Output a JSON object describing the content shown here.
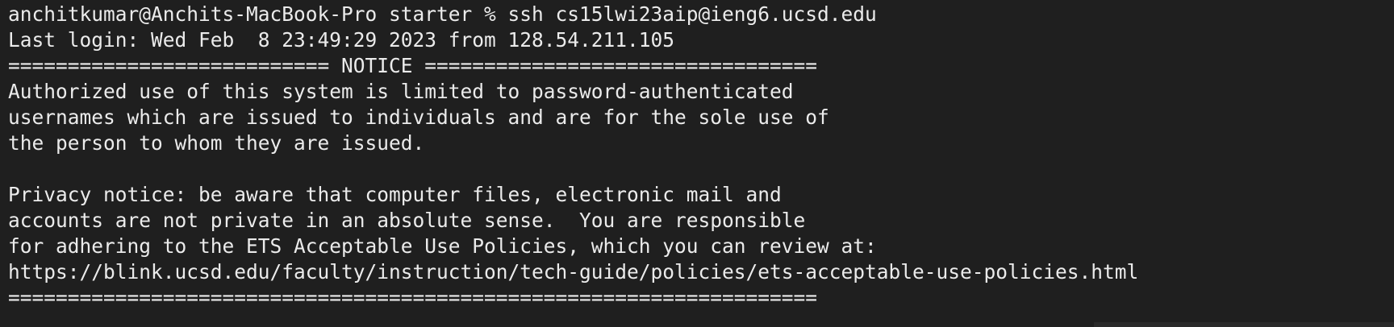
{
  "terminal": {
    "lines": [
      "anchitkumar@Anchits-MacBook-Pro starter % ssh cs15lwi23aip@ieng6.ucsd.edu",
      "Last login: Wed Feb  8 23:49:29 2023 from 128.54.211.105",
      "=========================== NOTICE =================================",
      "Authorized use of this system is limited to password-authenticated",
      "usernames which are issued to individuals and are for the sole use of",
      "the person to whom they are issued.",
      "",
      "Privacy notice: be aware that computer files, electronic mail and",
      "accounts are not private in an absolute sense.  You are responsible",
      "for adhering to the ETS Acceptable Use Policies, which you can review at:",
      "https://blink.ucsd.edu/faculty/instruction/tech-guide/policies/ets-acceptable-use-policies.html",
      "===================================================================="
    ]
  },
  "colors": {
    "background": "#1f1f1f",
    "text": "#ebebeb"
  }
}
